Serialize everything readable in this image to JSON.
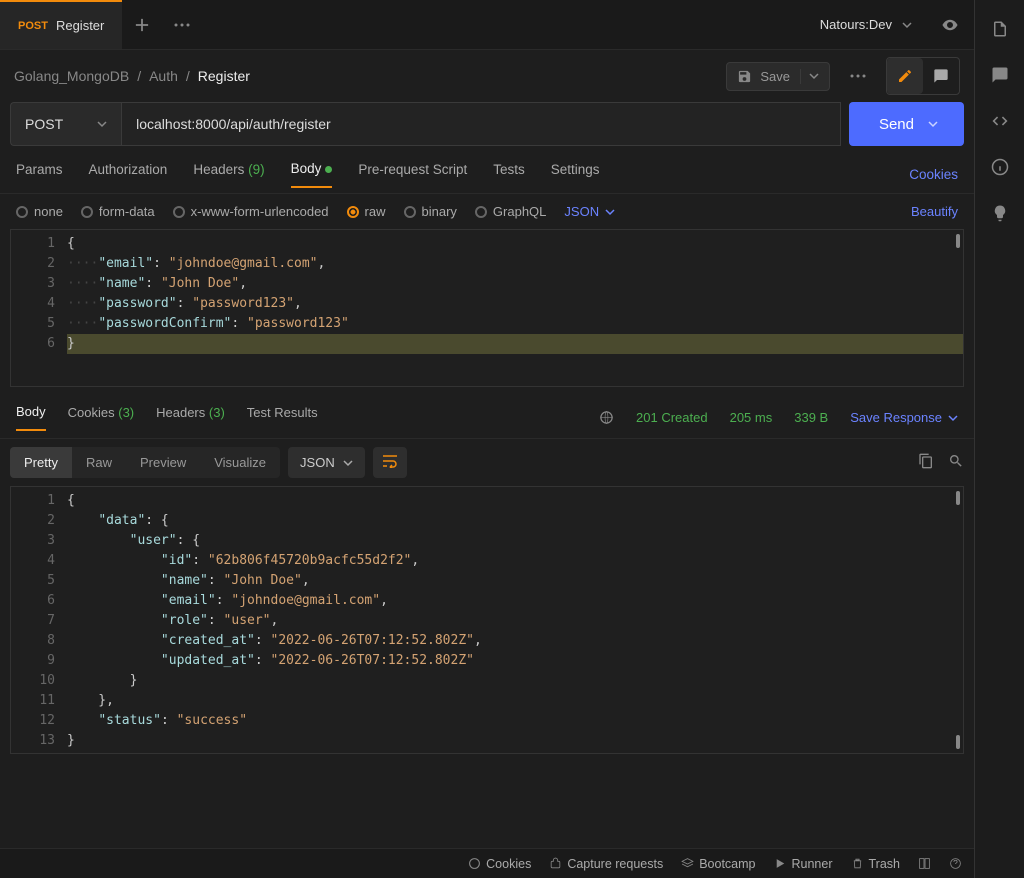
{
  "tab": {
    "method_badge": "POST",
    "name": "Register"
  },
  "environment": "Natours:Dev",
  "breadcrumbs": [
    "Golang_MongoDB",
    "Auth",
    "Register"
  ],
  "save_label": "Save",
  "method": "POST",
  "url": "localhost:8000/api/auth/register",
  "send_label": "Send",
  "request_tabs": {
    "params": "Params",
    "auth": "Authorization",
    "headers": "Headers",
    "headers_count": "(9)",
    "body": "Body",
    "prereq": "Pre-request Script",
    "tests": "Tests",
    "settings": "Settings",
    "cookies": "Cookies"
  },
  "body_types": {
    "none": "none",
    "formdata": "form-data",
    "urlenc": "x-www-form-urlencoded",
    "raw": "raw",
    "binary": "binary",
    "graphql": "GraphQL",
    "format": "JSON",
    "beautify": "Beautify"
  },
  "request_body_lines": [
    "{",
    "    \"email\": \"johndoe@gmail.com\",",
    "    \"name\": \"John Doe\",",
    "    \"password\": \"password123\",",
    "    \"passwordConfirm\": \"password123\"",
    "}"
  ],
  "response_tabs": {
    "body": "Body",
    "cookies": "Cookies",
    "cookies_count": "(3)",
    "headers": "Headers",
    "headers_count": "(3)",
    "tests": "Test Results"
  },
  "response_meta": {
    "status": "201 Created",
    "time": "205 ms",
    "size": "339 B",
    "save": "Save Response"
  },
  "viewmodes": {
    "pretty": "Pretty",
    "raw": "Raw",
    "preview": "Preview",
    "visualize": "Visualize",
    "format": "JSON"
  },
  "response_body_lines": [
    "{",
    "    \"data\": {",
    "        \"user\": {",
    "            \"id\": \"62b806f45720b9acfc55d2f2\",",
    "            \"name\": \"John Doe\",",
    "            \"email\": \"johndoe@gmail.com\",",
    "            \"role\": \"user\",",
    "            \"created_at\": \"2022-06-26T07:12:52.802Z\",",
    "            \"updated_at\": \"2022-06-26T07:12:52.802Z\"",
    "        }",
    "    },",
    "    \"status\": \"success\"",
    "}"
  ],
  "footer": {
    "cookies": "Cookies",
    "capture": "Capture requests",
    "bootcamp": "Bootcamp",
    "runner": "Runner",
    "trash": "Trash"
  }
}
